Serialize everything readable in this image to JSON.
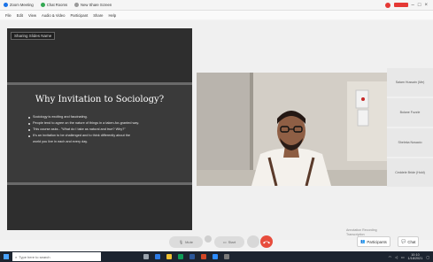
{
  "browser": {
    "tabs": [
      {
        "label": "Zoom Meeting"
      },
      {
        "label": "Chat Rooms"
      },
      {
        "label": "New Share Screen"
      }
    ]
  },
  "menu": [
    "File",
    "Edit",
    "View",
    "Audio & Video",
    "Participant",
    "Share",
    "Help"
  ],
  "share": {
    "sharing_label": "Sharing Slides Name",
    "slide_title": "Why Invitation to Sociology?",
    "bullets": [
      "Sociology is exciting and fascinating.",
      "People tend to agree on the nature of things in a taken-for-granted way.",
      "This course asks - \"What do I take as natural and true? Why?\"",
      "It's an invitation to be challenged and to think differently about the",
      "world you live in each and every day."
    ]
  },
  "participants": [
    {
      "name": "Salam Hussain (Me)"
    },
    {
      "name": "Bolane Fuzzle"
    },
    {
      "name": "Sheleka Nosacio"
    },
    {
      "name": "Ceddele Bride (Hold)"
    }
  ],
  "bottom_info": {
    "line1": "Annotation Recording",
    "line2": "Transcription"
  },
  "controls": {
    "mute_label": "Mute",
    "video_label": "Start",
    "participants_label": "Participants",
    "chat_label": "Chat"
  },
  "taskbar": {
    "search_placeholder": "Type here to search",
    "time": "10:10",
    "date": "1/18/2021"
  },
  "colors": {
    "leave_button": "#e74c3c",
    "share_panel_bg": "#2e2e2e",
    "taskbar_bg": "#1c2430"
  }
}
